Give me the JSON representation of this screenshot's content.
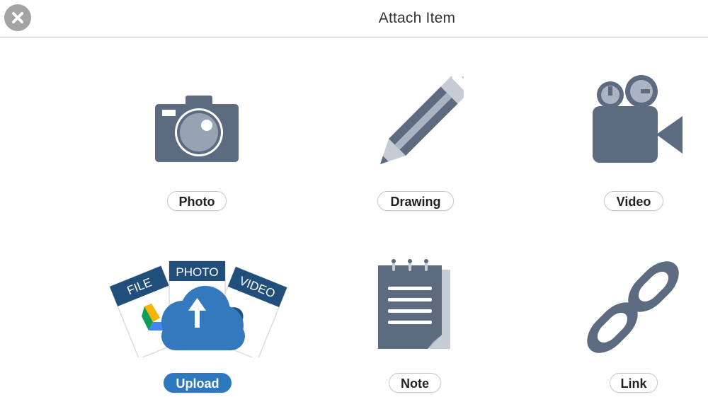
{
  "header": {
    "title": "Attach Item",
    "close_icon": "close-icon"
  },
  "colors": {
    "icon_slate": "#5d6b80",
    "icon_light": "#c5ccd6",
    "upload_blue": "#3478bd",
    "navy": "#1f4f7a",
    "close_bg": "#a3a3a3"
  },
  "items": [
    {
      "id": "photo",
      "label": "Photo",
      "icon": "camera-icon",
      "selected": false
    },
    {
      "id": "drawing",
      "label": "Drawing",
      "icon": "pencil-icon",
      "selected": false
    },
    {
      "id": "video",
      "label": "Video",
      "icon": "video-camera-icon",
      "selected": false
    },
    {
      "id": "upload",
      "label": "Upload",
      "icon": "cloud-upload-icon",
      "selected": true,
      "cards": [
        "FILE",
        "PHOTO",
        "VIDEO"
      ]
    },
    {
      "id": "note",
      "label": "Note",
      "icon": "notepad-icon",
      "selected": false
    },
    {
      "id": "link",
      "label": "Link",
      "icon": "chain-link-icon",
      "selected": false
    }
  ]
}
